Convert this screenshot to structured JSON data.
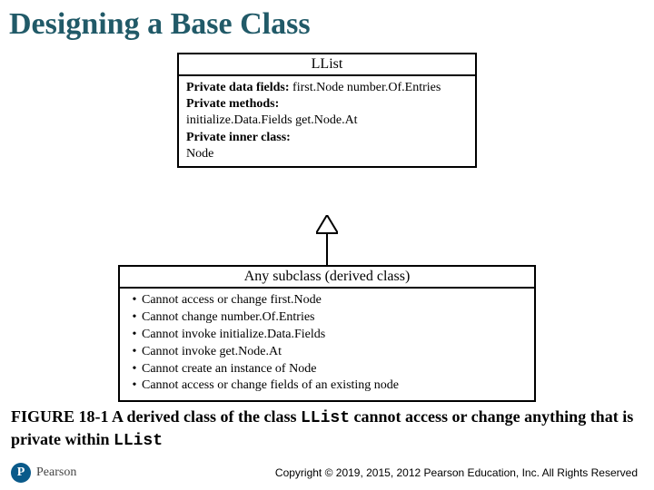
{
  "title": "Designing a Base Class",
  "llist": {
    "name": "LList",
    "privateFieldsLabel": "Private data fields:",
    "privateFieldsValue": " first.Node number.Of.Entries",
    "privateMethodsLabel": "Private methods:",
    "privateMethodsValue": "initialize.Data.Fields get.Node.At",
    "privateInnerLabel": "Private inner class:",
    "privateInnerValue": "Node"
  },
  "subclass": {
    "header": "Any subclass (derived class)",
    "bullets": [
      "Cannot access or change first.Node",
      "Cannot change number.Of.Entries",
      "Cannot invoke initialize.Data.Fields",
      "Cannot invoke get.Node.At",
      "Cannot create an instance of Node",
      "Cannot access or change fields of an existing node"
    ]
  },
  "figure": {
    "prefix": "FIGURE 18-1 A derived class of the class ",
    "code1": "LList",
    "mid": " cannot access or change anything that is private within ",
    "code2": "LList"
  },
  "footer": {
    "logoLetter": "P",
    "logoText": "Pearson",
    "copyright": "Copyright © 2019, 2015, 2012 Pearson Education, Inc. All Rights Reserved"
  },
  "chart_data": {
    "type": "diagram",
    "title": "UML-style inheritance diagram",
    "parent": {
      "name": "LList",
      "private_data_fields": [
        "first.Node",
        "number.Of.Entries"
      ],
      "private_methods": [
        "initialize.Data.Fields",
        "get.Node.At"
      ],
      "private_inner_class": [
        "Node"
      ]
    },
    "child": {
      "name": "Any subclass (derived class)",
      "restrictions": [
        "Cannot access or change first.Node",
        "Cannot change number.Of.Entries",
        "Cannot invoke initialize.Data.Fields",
        "Cannot invoke get.Node.At",
        "Cannot create an instance of Node",
        "Cannot access or change fields of an existing node"
      ]
    },
    "relationship": "inheritance (child -> parent, hollow triangle arrow)"
  }
}
